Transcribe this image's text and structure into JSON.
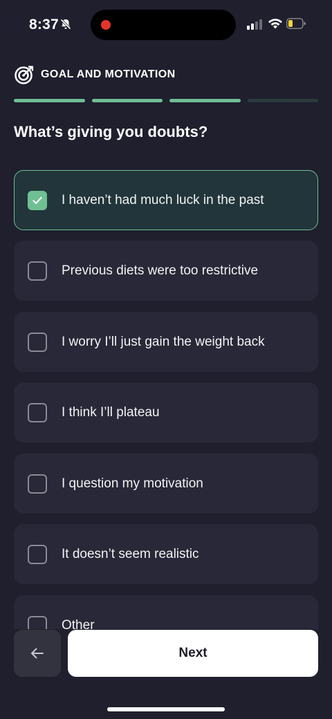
{
  "status_bar": {
    "time": "8:37",
    "icons": [
      "bell-slash-icon",
      "signal-icon",
      "wifi-icon",
      "battery-low-icon"
    ],
    "battery_color": "#f5d33a",
    "recording_dot_color": "#e5352b"
  },
  "header": {
    "icon": "target-icon",
    "title": "GOAL AND MOTIVATION"
  },
  "progress": {
    "completed_steps": 3,
    "total_steps": 4,
    "accent_color": "#6fbf93"
  },
  "question": "What’s giving you doubts?",
  "options": [
    {
      "label": "I haven’t had much luck in the past",
      "checked": true
    },
    {
      "label": "Previous diets were too restrictive",
      "checked": false
    },
    {
      "label": "I worry I’ll just gain the weight back",
      "checked": false
    },
    {
      "label": "I think I’ll plateau",
      "checked": false
    },
    {
      "label": "I question my motivation",
      "checked": false
    },
    {
      "label": "It doesn’t seem realistic",
      "checked": false
    },
    {
      "label": "Other",
      "checked": false
    }
  ],
  "footer": {
    "back_icon": "arrow-left-icon",
    "next_label": "Next"
  }
}
